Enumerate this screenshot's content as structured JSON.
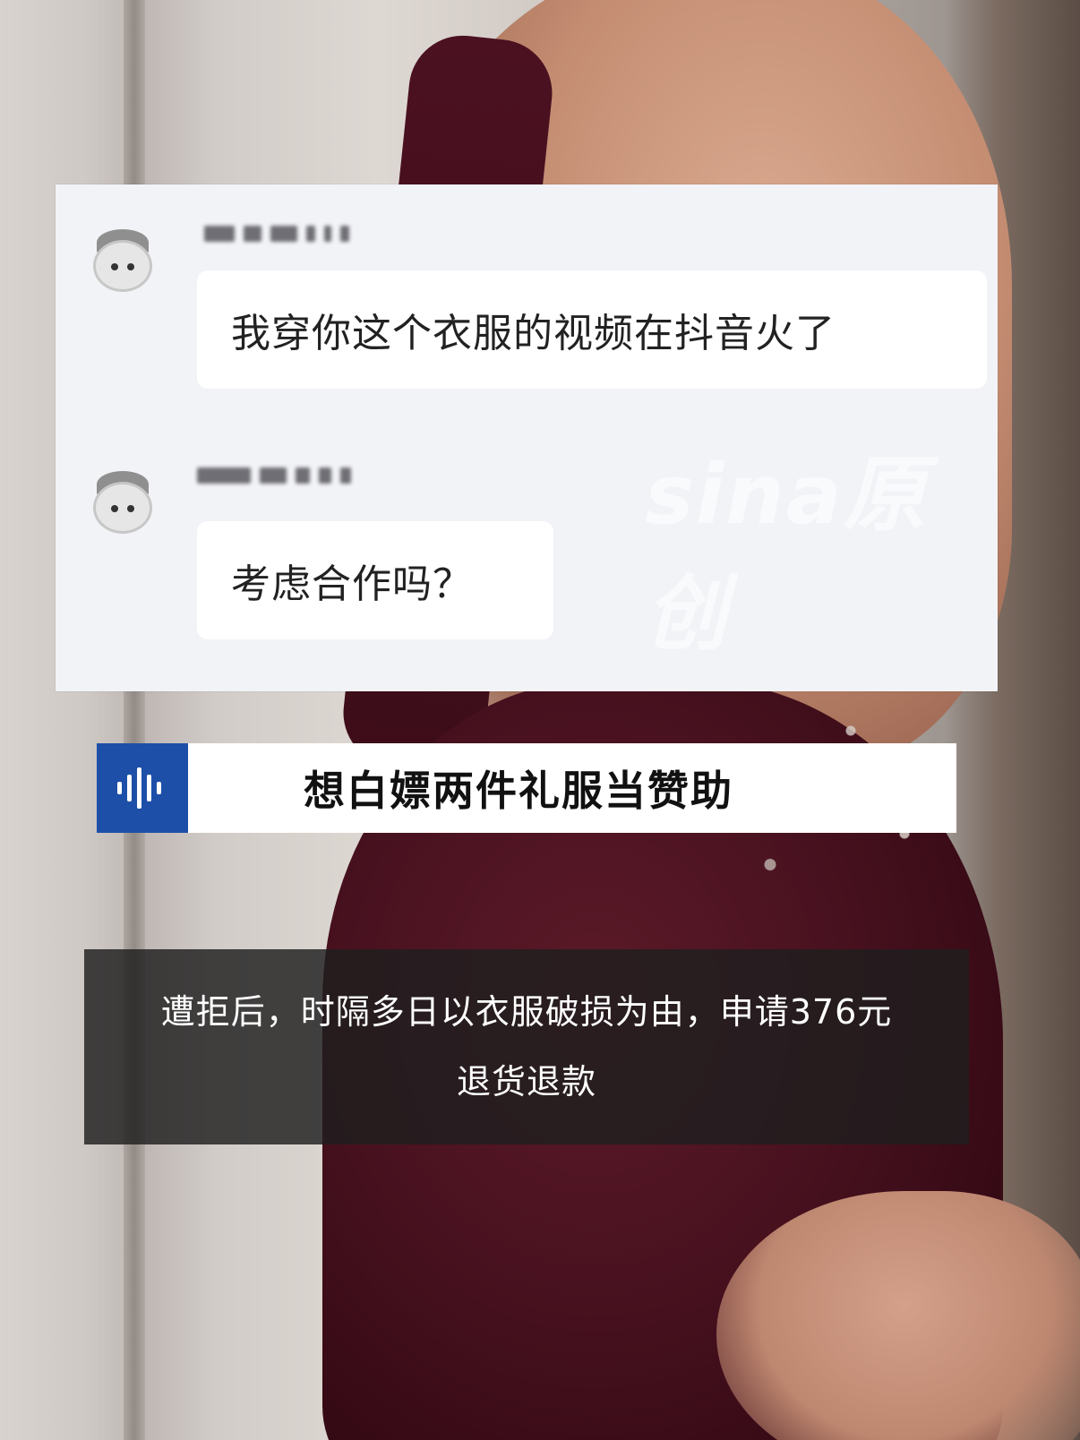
{
  "chat": {
    "messages": [
      {
        "text": "我穿你这个衣服的视频在抖音火了"
      },
      {
        "text": "考虑合作吗？"
      }
    ],
    "watermark": "sina原创"
  },
  "headline": {
    "title": "想白嫖两件礼服当赞助",
    "icon": "audio-waveform-icon"
  },
  "caption": {
    "line1": "遭拒后，时隔多日以衣服破损为由，申请376元",
    "line2": "退货退款"
  },
  "colors": {
    "headline_icon_bg": "#1d4fa8",
    "chat_bg": "#f2f3f7",
    "caption_bg": "#1e1e1e"
  }
}
